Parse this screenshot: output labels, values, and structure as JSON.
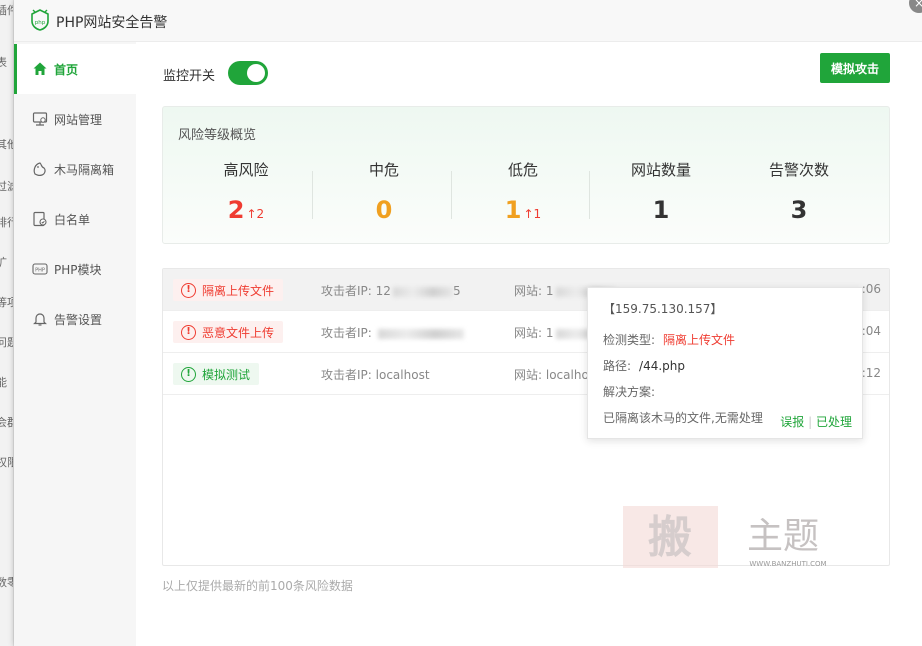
{
  "background": {
    "fragments": [
      "插件",
      "表",
      "其他",
      "过滤",
      "排行",
      "扩",
      "等项",
      "问题",
      "能",
      "会群",
      "权限",
      "数零"
    ]
  },
  "window": {
    "title": "PHP网站安全告警",
    "logo_text": "php",
    "close_symbol": "×"
  },
  "sidebar": {
    "items": [
      {
        "label": "首页",
        "icon": "home-icon"
      },
      {
        "label": "网站管理",
        "icon": "site-manage-icon"
      },
      {
        "label": "木马隔离箱",
        "icon": "quarantine-icon"
      },
      {
        "label": "白名单",
        "icon": "whitelist-icon"
      },
      {
        "label": "PHP模块",
        "icon": "php-module-icon"
      },
      {
        "label": "告警设置",
        "icon": "bell-icon"
      }
    ]
  },
  "main": {
    "switch_label": "监控开关",
    "switch_on": true,
    "simulate_button": "模拟攻击",
    "overview": {
      "title": "风险等级概览",
      "stats": [
        {
          "label": "高风险",
          "value": "2",
          "trend": "↑2",
          "color": "#ef3c31"
        },
        {
          "label": "中危",
          "value": "0",
          "trend": "",
          "color": "#f0a020"
        },
        {
          "label": "低危",
          "value": "1",
          "trend": "↑1",
          "color": "#f0a020"
        },
        {
          "label": "网站数量",
          "value": "1",
          "trend": "",
          "color": "#333333"
        },
        {
          "label": "告警次数",
          "value": "3",
          "trend": "",
          "color": "#333333"
        }
      ]
    },
    "alerts": [
      {
        "tag": "隔离上传文件",
        "level": "red",
        "attacker_label": "攻击者IP:",
        "attacker_ip": "12",
        "attacker_tail": "5",
        "site_label": "网站:",
        "site": "1",
        "time": ":06"
      },
      {
        "tag": "恶意文件上传",
        "level": "red",
        "attacker_label": "攻击者IP:",
        "attacker_ip": "",
        "attacker_tail": "",
        "site_label": "网站:",
        "site": "1",
        "time": ":04"
      },
      {
        "tag": "模拟测试",
        "level": "green",
        "attacker_label": "攻击者IP:",
        "attacker_ip": "localhost",
        "attacker_tail": "",
        "site_label": "网站:",
        "site": "localhost",
        "time": ":12"
      }
    ],
    "footer_note": "以上仅提供最新的前100条风险数据",
    "popover": {
      "ip": "【159.75.130.157】",
      "type_label": "检测类型:",
      "type_value": "隔离上传文件",
      "path_label": "路径:",
      "path_value": "/44.php",
      "solution_label": "解决方案:",
      "solution_value": "已隔离该木马的文件,无需处理",
      "action_false": "误报",
      "separator": "|",
      "action_handled": "已处理"
    }
  },
  "watermark": {
    "text": "主题",
    "url": "WWW.BANZHUTI.COM"
  },
  "colors": {
    "accent": "#20a53a",
    "danger": "#ef3c31",
    "warning": "#f0a020"
  }
}
